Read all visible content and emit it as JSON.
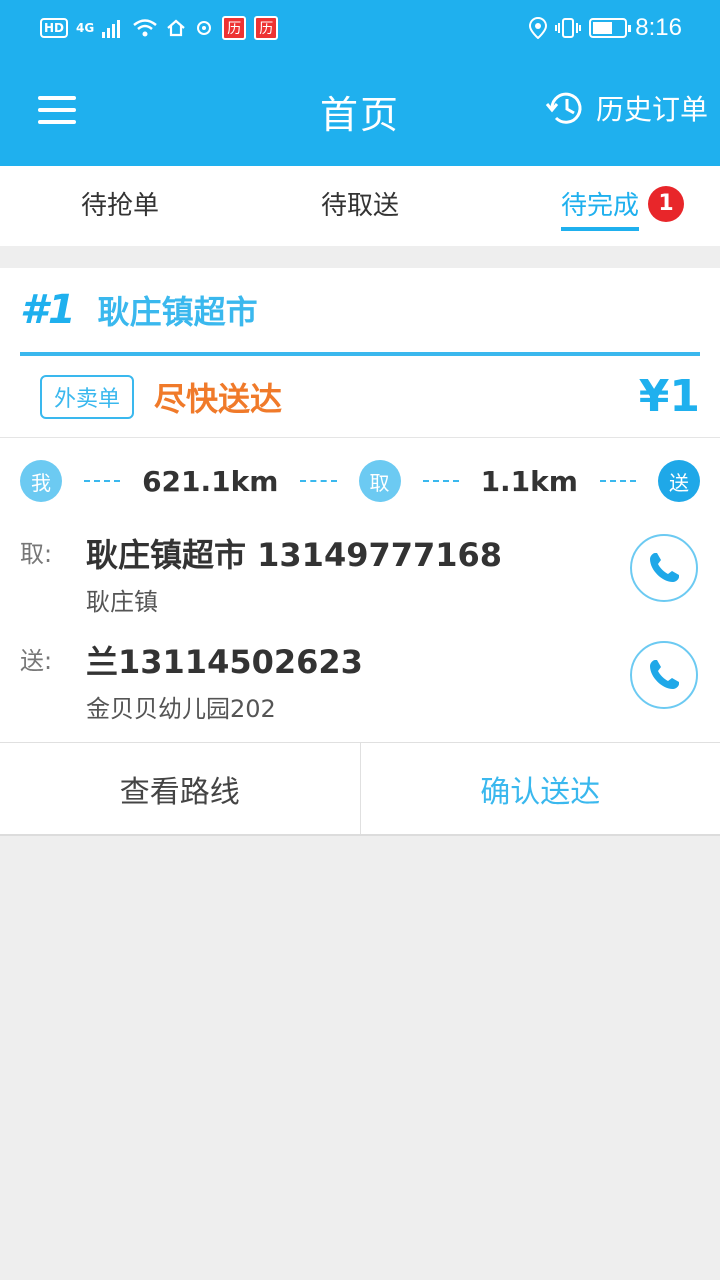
{
  "status_bar": {
    "hd": "HD",
    "network": "4G",
    "app_icon_1": "历",
    "app_icon_2": "历",
    "time": "8:16"
  },
  "header": {
    "title": "首页",
    "history_label": "历史订单"
  },
  "tabs": [
    {
      "label": "待抢单"
    },
    {
      "label": "待取送"
    },
    {
      "label": "待完成",
      "badge": "1"
    }
  ],
  "order": {
    "number": "#1",
    "shop": "耿庄镇超市",
    "tag": "外卖单",
    "urgency": "尽快送达",
    "price": "¥1",
    "route": {
      "me_label": "我",
      "pickup_label": "取",
      "deliver_label": "送",
      "distance_to_pickup": "621.1km",
      "distance_to_deliver": "1.1km"
    },
    "pickup": {
      "label": "取:",
      "main": "耿庄镇超市 13149777168",
      "sub": "耿庄镇"
    },
    "delivery": {
      "label": "送:",
      "main": "兰13114502623",
      "sub": "金贝贝幼儿园202"
    },
    "actions": {
      "view_route": "查看路线",
      "confirm_delivery": "确认送达"
    }
  },
  "colors": {
    "primary": "#1fb0ee",
    "accent_orange": "#f07a2a",
    "badge_red": "#e8262a"
  }
}
